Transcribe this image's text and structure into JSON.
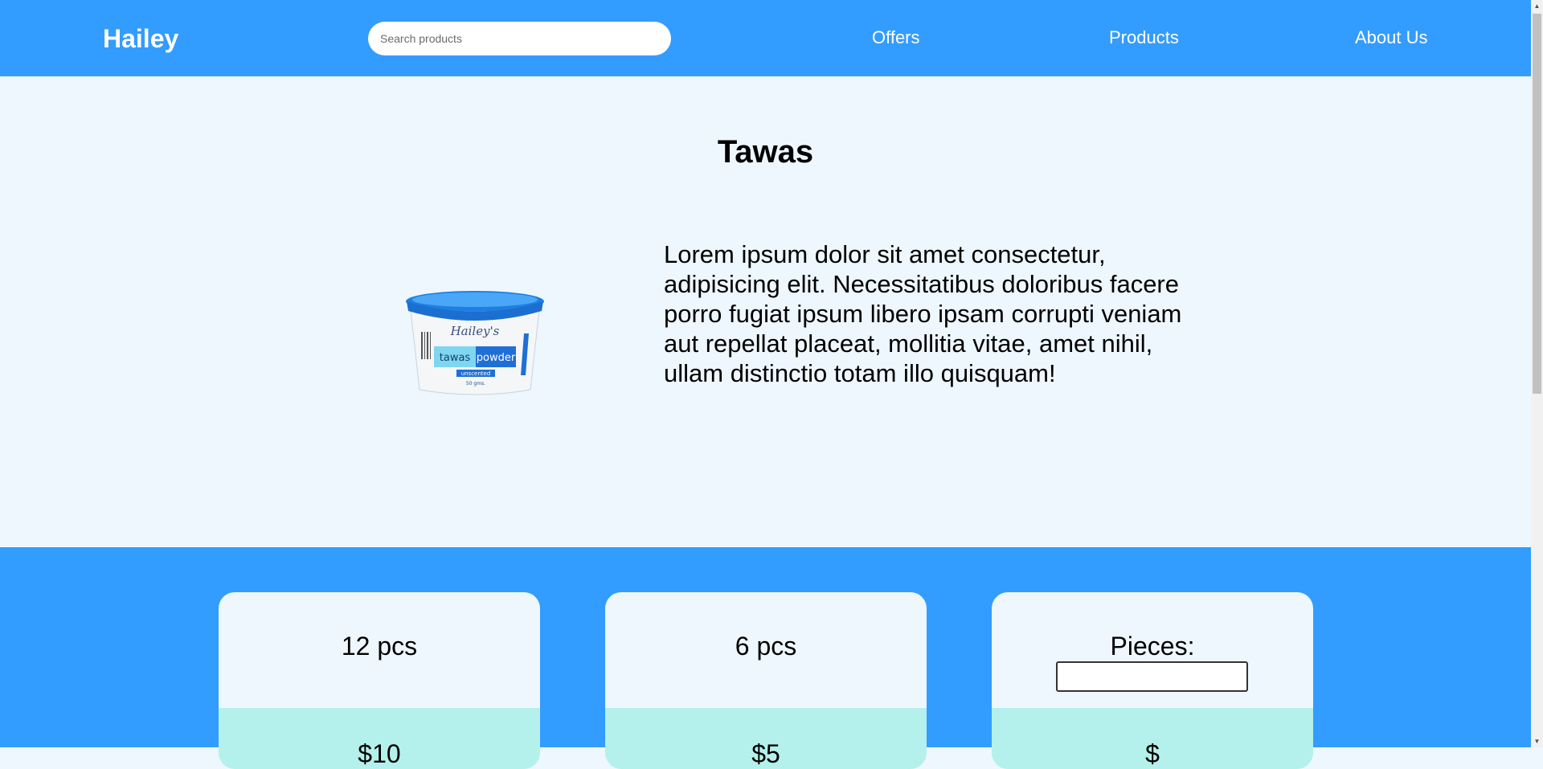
{
  "header": {
    "brand": "Hailey",
    "search_placeholder": "Search products",
    "nav": [
      "Offers",
      "Products",
      "About Us"
    ]
  },
  "product": {
    "title": "Tawas",
    "image_alt": "tawas powder tub",
    "image_label": {
      "brand": "Hailey's",
      "word1": "tawas",
      "word2": "powder",
      "variant": "unscented",
      "weight": "50 gms."
    },
    "description": "Lorem ipsum dolor sit amet consectetur, adipisicing elit. Necessitatibus doloribus facere porro fugiat ipsum libero ipsam corrupti veniam aut repellat placeat, mollitia vitae, amet nihil, ullam distinctio totam illo quisquam!"
  },
  "pricing": {
    "cards": [
      {
        "label": "12 pcs",
        "price": "$10"
      },
      {
        "label": "6 pcs",
        "price": "$5"
      },
      {
        "label": "Pieces:",
        "price": "$"
      }
    ]
  },
  "colors": {
    "primary": "#339cff",
    "background": "#eef7fe",
    "price_band": "#b4f1ec"
  }
}
